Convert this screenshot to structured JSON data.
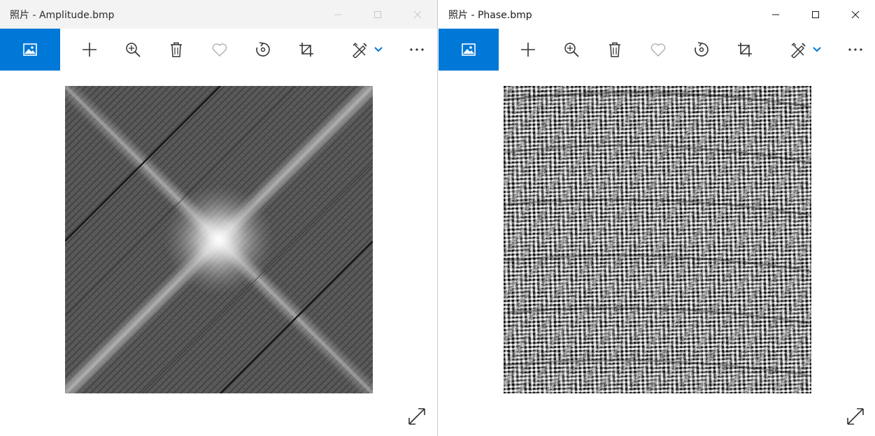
{
  "windows": [
    {
      "title": "照片 - Amplitude.bmp",
      "image_name": "Amplitude.bmp",
      "focused": false
    },
    {
      "title": "照片 - Phase.bmp",
      "image_name": "Phase.bmp",
      "focused": true
    }
  ],
  "toolbar_icons": [
    "view-all-photos-icon",
    "add-to-icon",
    "zoom-icon",
    "delete-icon",
    "favorite-icon",
    "rotate-icon",
    "crop-icon",
    "edit-draw-icon",
    "dropdown-chevron-icon",
    "more-icon"
  ],
  "colors": {
    "accent": "#0078d7",
    "icon": "#333333",
    "icon_inactive": "#c0c0c0"
  }
}
